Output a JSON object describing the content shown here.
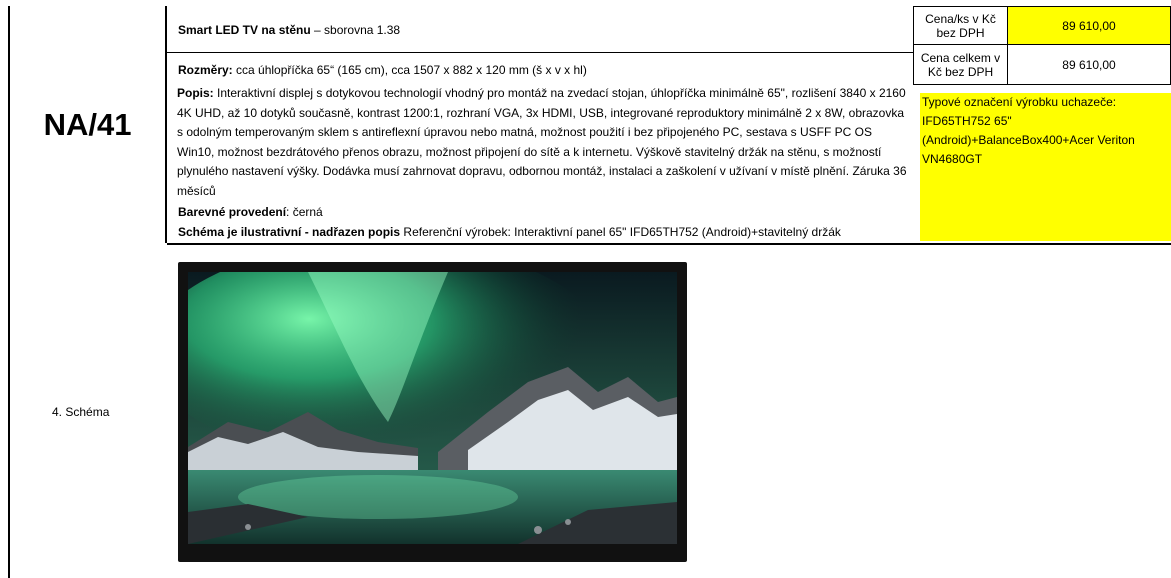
{
  "item": {
    "code": "NA/41",
    "title_bold": "Smart LED TV na stěnu",
    "title_rest": " – sborovna 1.38",
    "dimensions_label": "Rozměry:",
    "dimensions_text": " cca   úhlopříčka 65“ (165 cm),  cca 1507 x 882 x 120 mm (š x v x hl)",
    "description_label": "Popis:",
    "description_text": " Interaktivní displej s dotykovou technologií vhodný pro montáž na zvedací stojan, úhlopříčka minimálně 65\", rozlišení 3840 x 2160 4K UHD, až 10 dotyků současně, kontrast 1200:1, rozhraní VGA, 3x HDMI, USB, integrované reproduktory minimálně 2 x 8W, obrazovka s odolným temperovaným sklem s antireflexní úpravou nebo matná, možnost použití i bez připojeného PC, sestava s USFF PC OS Win10, možnost bezdrátového přenos obrazu, možnost připojení do sítě a k internetu. Výškově stavitelný držák na stěnu, s možností plynulého nastavení výšky. Dodávka musí zahrnovat dopravu, odbornou montáž, instalaci a zaškolení v užívaní v místě plnění. Záruka 36 měsíců",
    "color_label": "Barevné provedení",
    "color_text": ": černá",
    "schema_note_bold": "Schéma je ilustrativní - nadřazen popis",
    "schema_note_text": "  Referenční výrobek: Interaktivní panel 65\" IFD65TH752 (Android)+stavitelný držák"
  },
  "pricing": {
    "unit_price_label": "Cena/ks v Kč bez DPH",
    "unit_price_value": "89 610,00",
    "total_price_label": "Cena celkem v Kč bez DPH",
    "total_price_value": "89 610,00",
    "product_designation": "Typové označení výrobku uchazeče: IFD65TH752 65\" (Android)+BalanceBox400+Acer Veriton VN4680GT"
  },
  "schema": {
    "label": "4. Schéma"
  },
  "colors": {
    "highlight": "#ffff00",
    "border": "#000000"
  }
}
